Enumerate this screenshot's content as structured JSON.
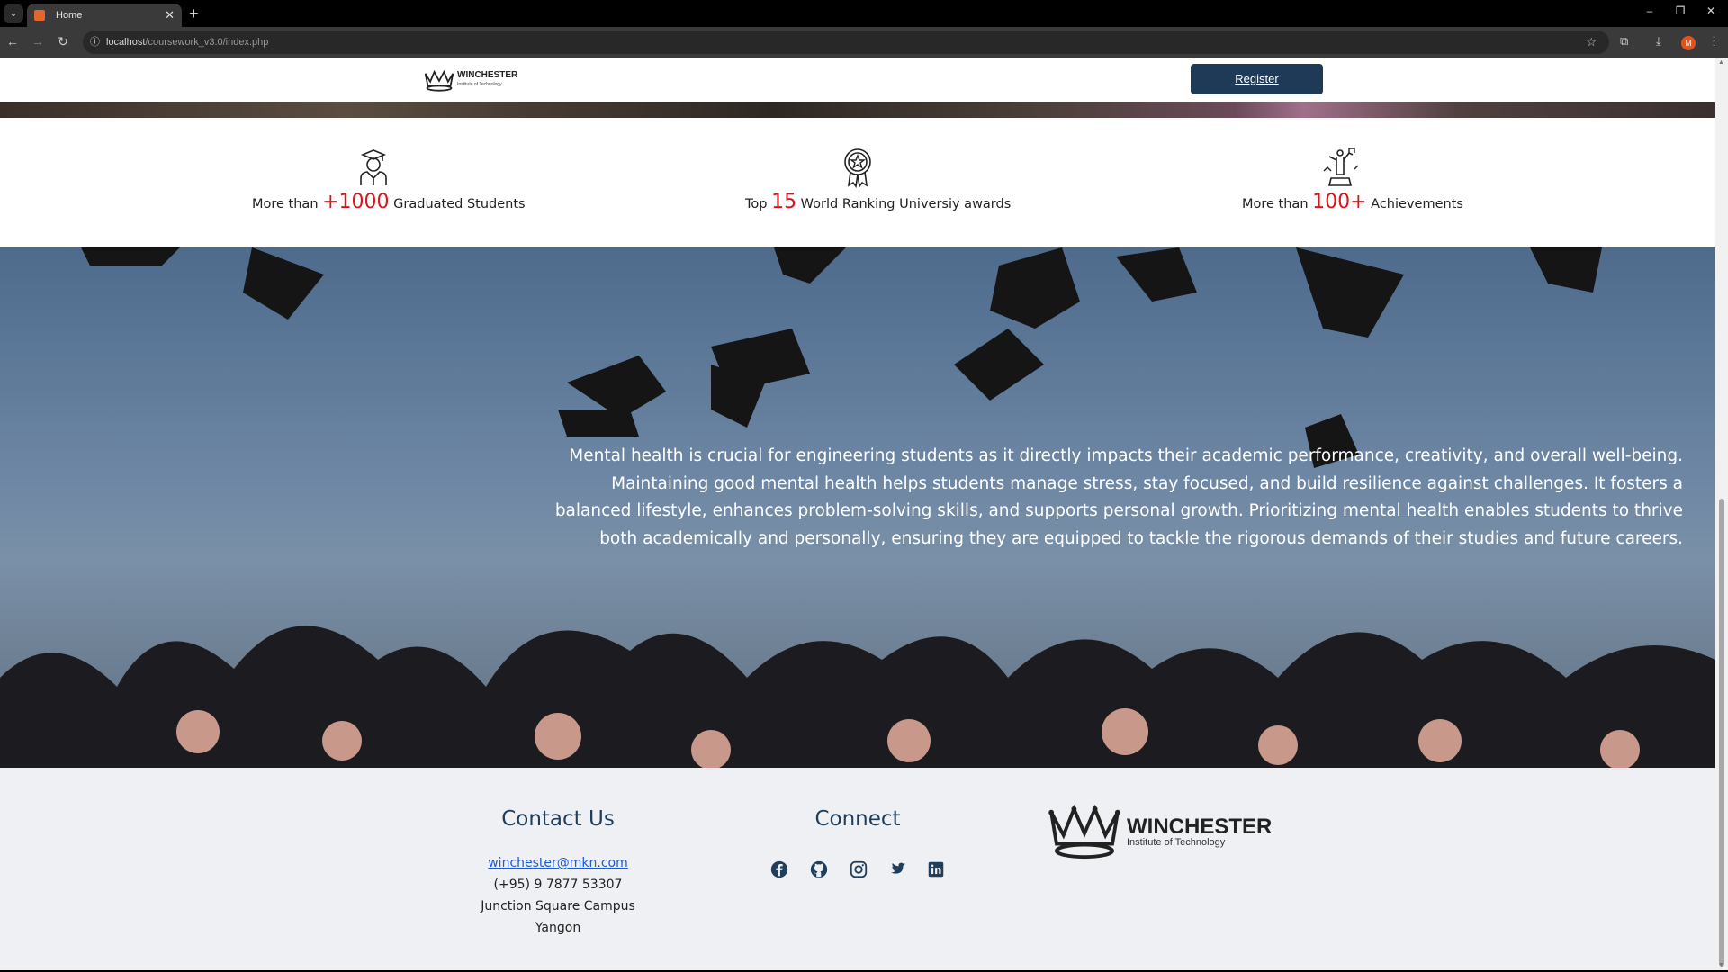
{
  "browser": {
    "tab_title": "Home",
    "url_host": "localhost",
    "url_path": "/coursework_v3.0/index.php",
    "avatar_letter": "M"
  },
  "header": {
    "logo_name": "WINCHESTER",
    "logo_tagline": "Institute of Technology",
    "register_label": "Register"
  },
  "stats": [
    {
      "prefix": "More than ",
      "number": "+1000",
      "suffix": " Graduated Students",
      "icon": "graduate-icon"
    },
    {
      "prefix": "Top ",
      "number": "15",
      "suffix": " World Ranking Universiy awards",
      "icon": "award-medal-icon"
    },
    {
      "prefix": "More than ",
      "number": "100+",
      "suffix": " Achievements",
      "icon": "trophy-icon"
    }
  ],
  "stats_accent_color": "#d8151c",
  "mental_health_text": "Mental health is crucial for engineering students as it directly impacts their academic performance, creativity, and overall well-being. Maintaining good mental health helps students manage stress, stay focused, and build resilience against challenges. It fosters a balanced lifestyle, enhances problem-solving skills, and supports personal growth. Prioritizing mental health enables students to thrive both academically and personally, ensuring they are equipped to tackle the rigorous demands of their studies and future careers.",
  "footer": {
    "contact_title": "Contact Us",
    "email": "winchester@mkn.com",
    "phone": "(+95) 9 7877 53307",
    "campus": "Junction Square Campus",
    "city": "Yangon",
    "connect_title": "Connect",
    "social_icons": [
      "facebook-icon",
      "github-icon",
      "instagram-icon",
      "twitter-icon",
      "linkedin-icon"
    ],
    "logo_name": "WINCHESTER",
    "logo_tagline": "Institute of Technology"
  },
  "colors": {
    "brand_navy": "#1e3a56",
    "footer_title": "#1f3e5c",
    "link": "#1a5bd6"
  }
}
